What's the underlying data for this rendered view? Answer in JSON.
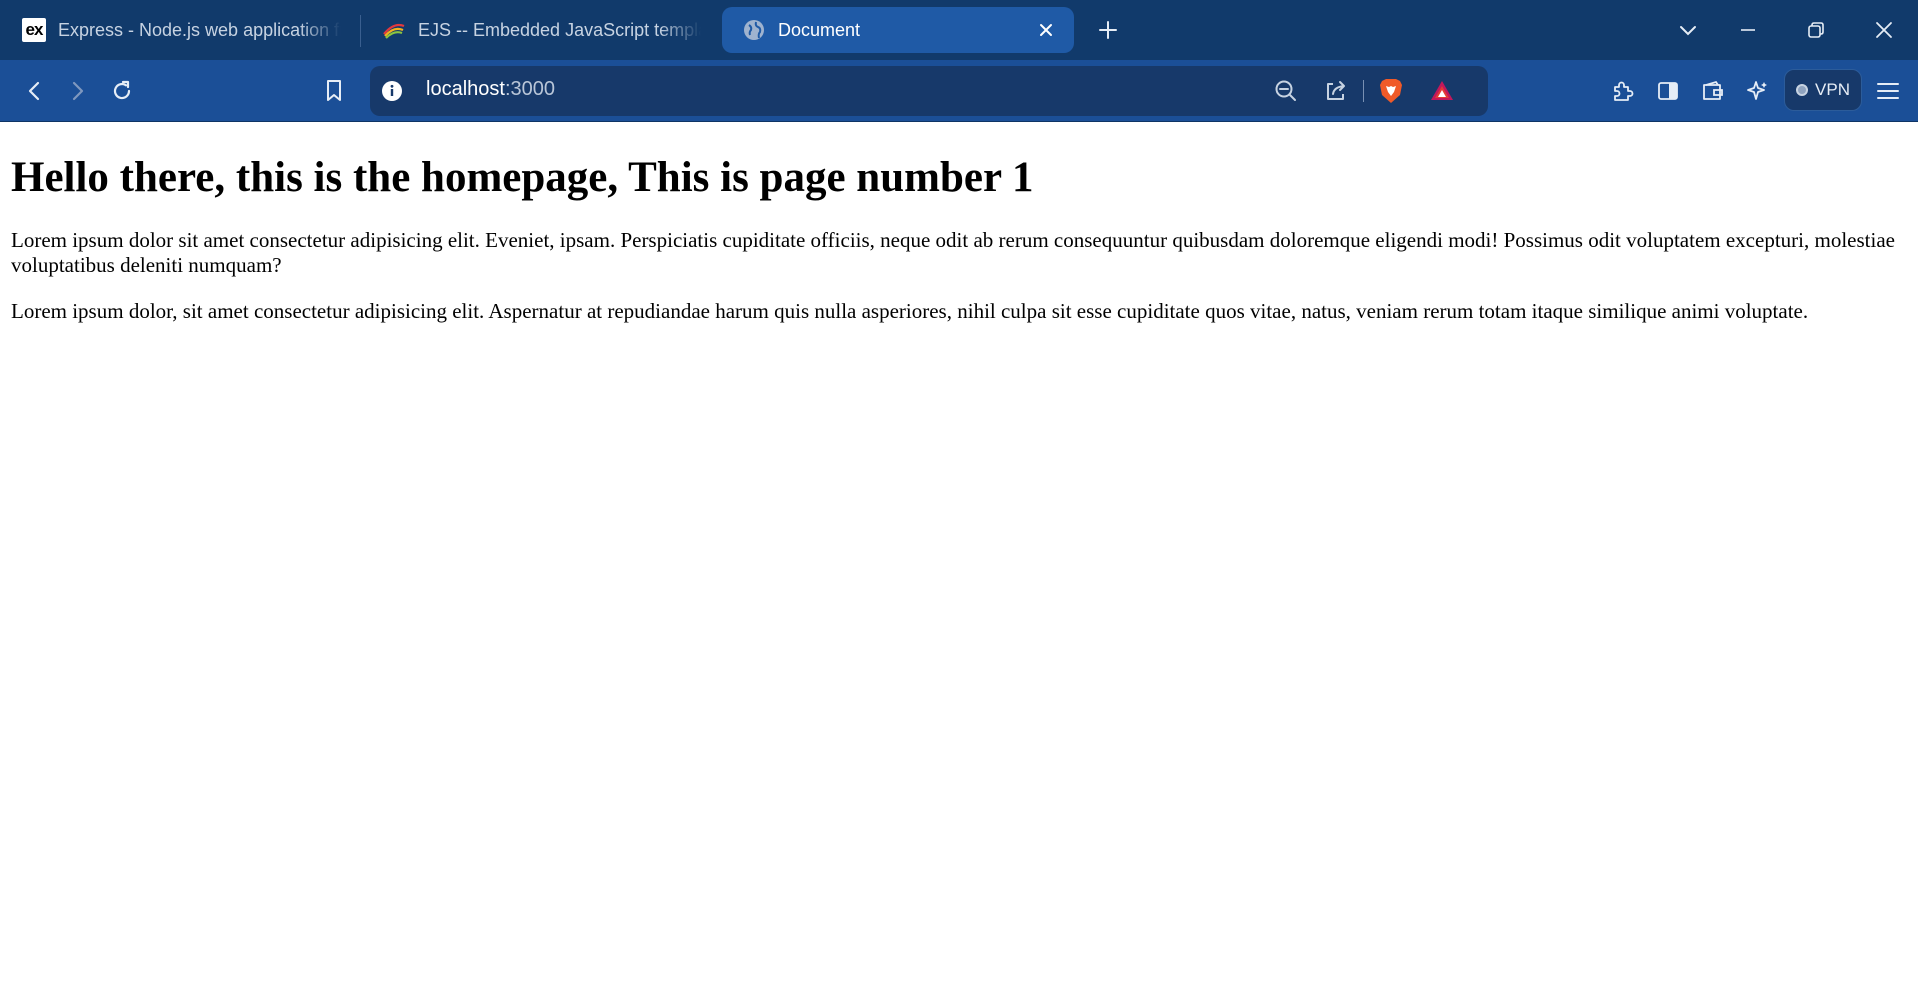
{
  "tabs": [
    {
      "title": "Express - Node.js web application fr",
      "favicon": "express-icon",
      "active": false
    },
    {
      "title": "EJS -- Embedded JavaScript templat",
      "favicon": "ejs-icon",
      "active": false
    },
    {
      "title": "Document",
      "favicon": "globe-icon",
      "active": true
    }
  ],
  "toolbar": {
    "url_host": "localhost",
    "url_port": ":3000",
    "vpn_label": "VPN"
  },
  "page": {
    "heading": "Hello there, this is the homepage, This is page number 1",
    "paragraphs": [
      "Lorem ipsum dolor sit amet consectetur adipisicing elit. Eveniet, ipsam. Perspiciatis cupiditate officiis, neque odit ab rerum consequuntur quibusdam doloremque eligendi modi! Possimus odit voluptatem excepturi, molestiae voluptatibus deleniti numquam?",
      "Lorem ipsum dolor, sit amet consectetur adipisicing elit. Aspernatur at repudiandae harum quis nulla asperiores, nihil culpa sit esse cupiditate quos vitae, natus, veniam rerum totam itaque similique animi voluptate."
    ]
  },
  "colors": {
    "tabstrip_bg": "#113a6b",
    "toolbar_bg": "#1b4f97",
    "active_tab_bg": "#1f5aa6",
    "brave_shield": "#f05a28"
  },
  "favicon_text": {
    "express": "ex"
  }
}
